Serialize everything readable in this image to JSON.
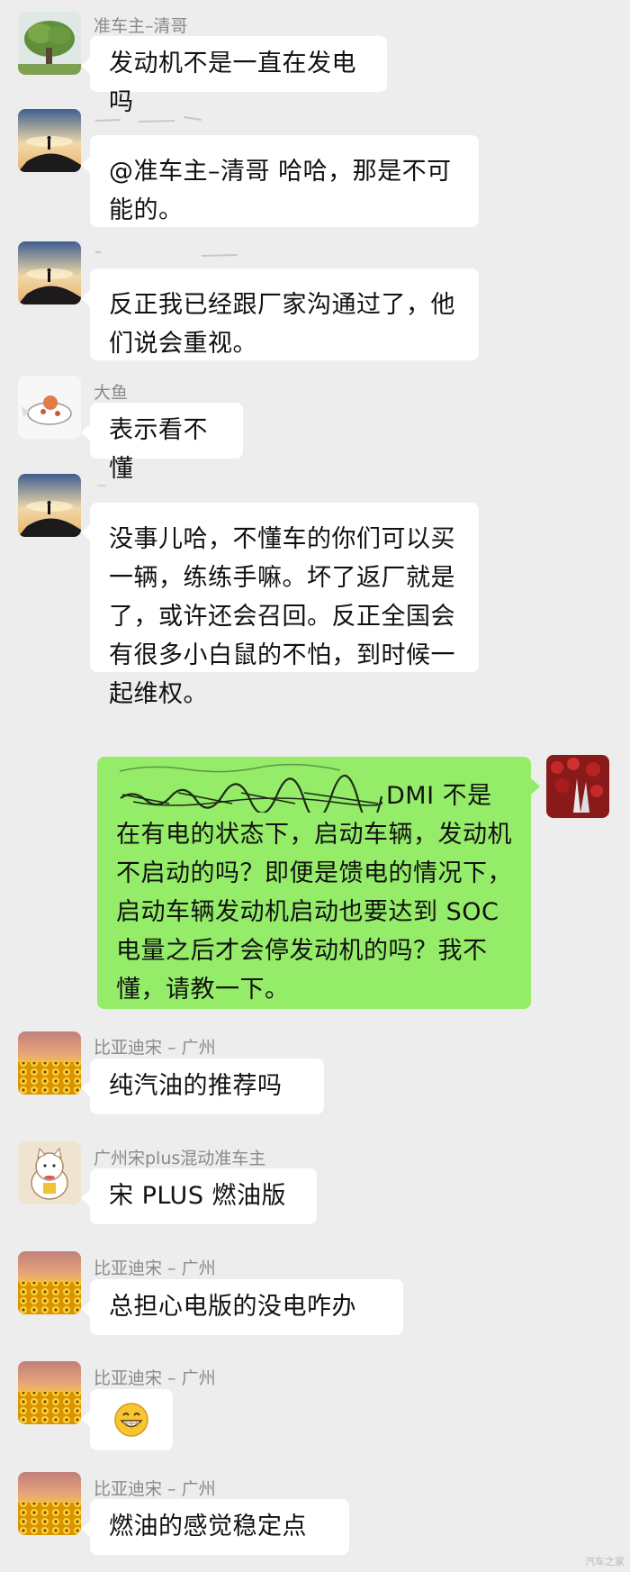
{
  "messages": [
    {
      "name": "准车主–清哥",
      "text": "发动机不是一直在发电吗"
    },
    {
      "name": "",
      "text": "@准车主–清哥  哈哈，那是不可能的。"
    },
    {
      "name": "",
      "text": "反正我已经跟厂家沟通过了，他们说会重视。"
    },
    {
      "name": "大鱼",
      "text": "表示看不懂"
    },
    {
      "name": "",
      "text": "没事儿哈，不懂车的你们可以买一辆，练练手嘛。坏了返厂就是了，或许还会召回。反正全国会有很多小白鼠的不怕，到时候一起维权。"
    },
    {
      "name": "",
      "text": "DMI 不是在有电的状态下，启动车辆，发动机不启动的吗？即便是馈电的情况下，启动车辆发动机启动也要达到 SOC 电量之后才会停发动机的吗？我不懂，请教一下。"
    },
    {
      "name": "比亚迪宋 – 广州",
      "text": "纯汽油的推荐吗"
    },
    {
      "name": "广州宋plus混动准车主",
      "text": "宋 PLUS 燃油版"
    },
    {
      "name": "比亚迪宋 – 广州",
      "text": "总担心电版的没电咋办"
    },
    {
      "name": "比亚迪宋 – 广州",
      "text": "grin-emoji"
    },
    {
      "name": "比亚迪宋 – 广州",
      "text": "燃油的感觉稳定点"
    }
  ],
  "watermark": "汽车之家",
  "colors": {
    "background": "#ededed",
    "bubble_left": "#ffffff",
    "bubble_right": "#95ec69",
    "name_text": "#8a8a8a"
  }
}
